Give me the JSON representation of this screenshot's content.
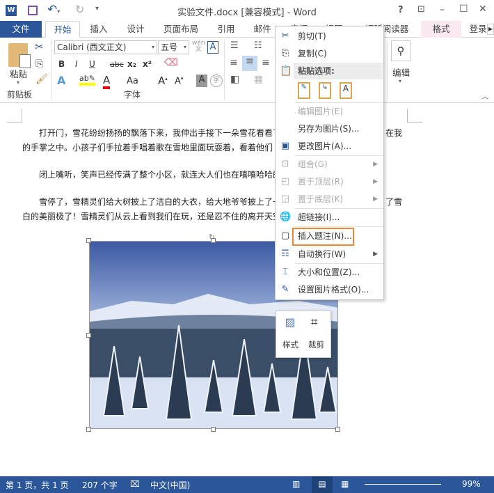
{
  "title": "实验文件.docx [兼容模式] - Word",
  "window_buttons": {
    "help": "?",
    "restore_ribbon": "⊡",
    "minimize": "–",
    "maximize": "☐",
    "close": "✕"
  },
  "tabs": [
    {
      "label": "文件"
    },
    {
      "label": "开始"
    },
    {
      "label": "插入"
    },
    {
      "label": "设计"
    },
    {
      "label": "页面布局"
    },
    {
      "label": "引用"
    },
    {
      "label": "邮件"
    },
    {
      "label": "审阅"
    },
    {
      "label": "视图"
    },
    {
      "label": "福昕阅读器"
    },
    {
      "label": "格式"
    },
    {
      "label": "登录"
    }
  ],
  "ribbon": {
    "paste": "粘贴",
    "clipboard_group": "剪贴板",
    "font_group": "字体",
    "edit": "编辑",
    "font_name": "Calibri (西文正文)",
    "font_size": "五号",
    "bold": "B",
    "italic": "I",
    "underline": "U",
    "strike": "abc",
    "subscript": "x₂",
    "superscript": "x²",
    "aa": "Aa"
  },
  "document": {
    "paragraphs": [
      "打开门，雪花纷纷扬扬的飘落下来，我伸出手接下一朵雪花看看了",
      "在我",
      "的手掌之中。小孩子们手拉着手唱着歌在雪地里面玩耍着，看着他们",
      "闭上嘴听，笑声已经传满了整个小区，就连大人们也在嘻嘻哈哈的",
      "雪停了，雪精灵们给大树披上了洁白的大衣，给大地爷爷披上了一",
      "了雪",
      "白的美丽极了！雪精灵们从云上看到我们在玩，还是忍不住的离开天空"
    ]
  },
  "context_menu": {
    "items": [
      {
        "label": "剪切(T)",
        "icon": "scissors-icon",
        "disabled": false
      },
      {
        "label": "复制(C)",
        "icon": "copy-icon",
        "disabled": false
      },
      {
        "label": "粘贴选项:",
        "icon": "paste-icon",
        "disabled": false
      },
      {
        "label": "编辑图片(E)",
        "disabled": true
      },
      {
        "label": "另存为图片(S)...",
        "disabled": false
      },
      {
        "label": "更改图片(A)...",
        "icon": "change-picture-icon",
        "disabled": false
      },
      {
        "label": "组合(G)",
        "icon": "group-icon",
        "disabled": true
      },
      {
        "label": "置于顶层(R)",
        "icon": "bring-front-icon",
        "disabled": true
      },
      {
        "label": "置于底层(K)",
        "icon": "send-back-icon",
        "disabled": true
      },
      {
        "label": "超链接(I)...",
        "icon": "hyperlink-icon",
        "disabled": false
      },
      {
        "label": "插入题注(N)...",
        "icon": "caption-icon",
        "disabled": false,
        "highlighted": true
      },
      {
        "label": "自动换行(W)",
        "icon": "wrap-text-icon",
        "disabled": false
      },
      {
        "label": "大小和位置(Z)...",
        "icon": "size-position-icon",
        "disabled": false
      },
      {
        "label": "设置图片格式(O)...",
        "icon": "format-picture-icon",
        "disabled": false
      }
    ]
  },
  "mini_toolbar": {
    "style": "样式",
    "crop": "裁剪"
  },
  "status": {
    "page": "第 1 页，共 1 页",
    "words": "207 个字",
    "language": "中文(中国)",
    "zoom": "99%"
  },
  "colors": {
    "accent": "#2b579a",
    "highlight_box": "#e8873a",
    "format_tab": "#fbe9f2"
  }
}
